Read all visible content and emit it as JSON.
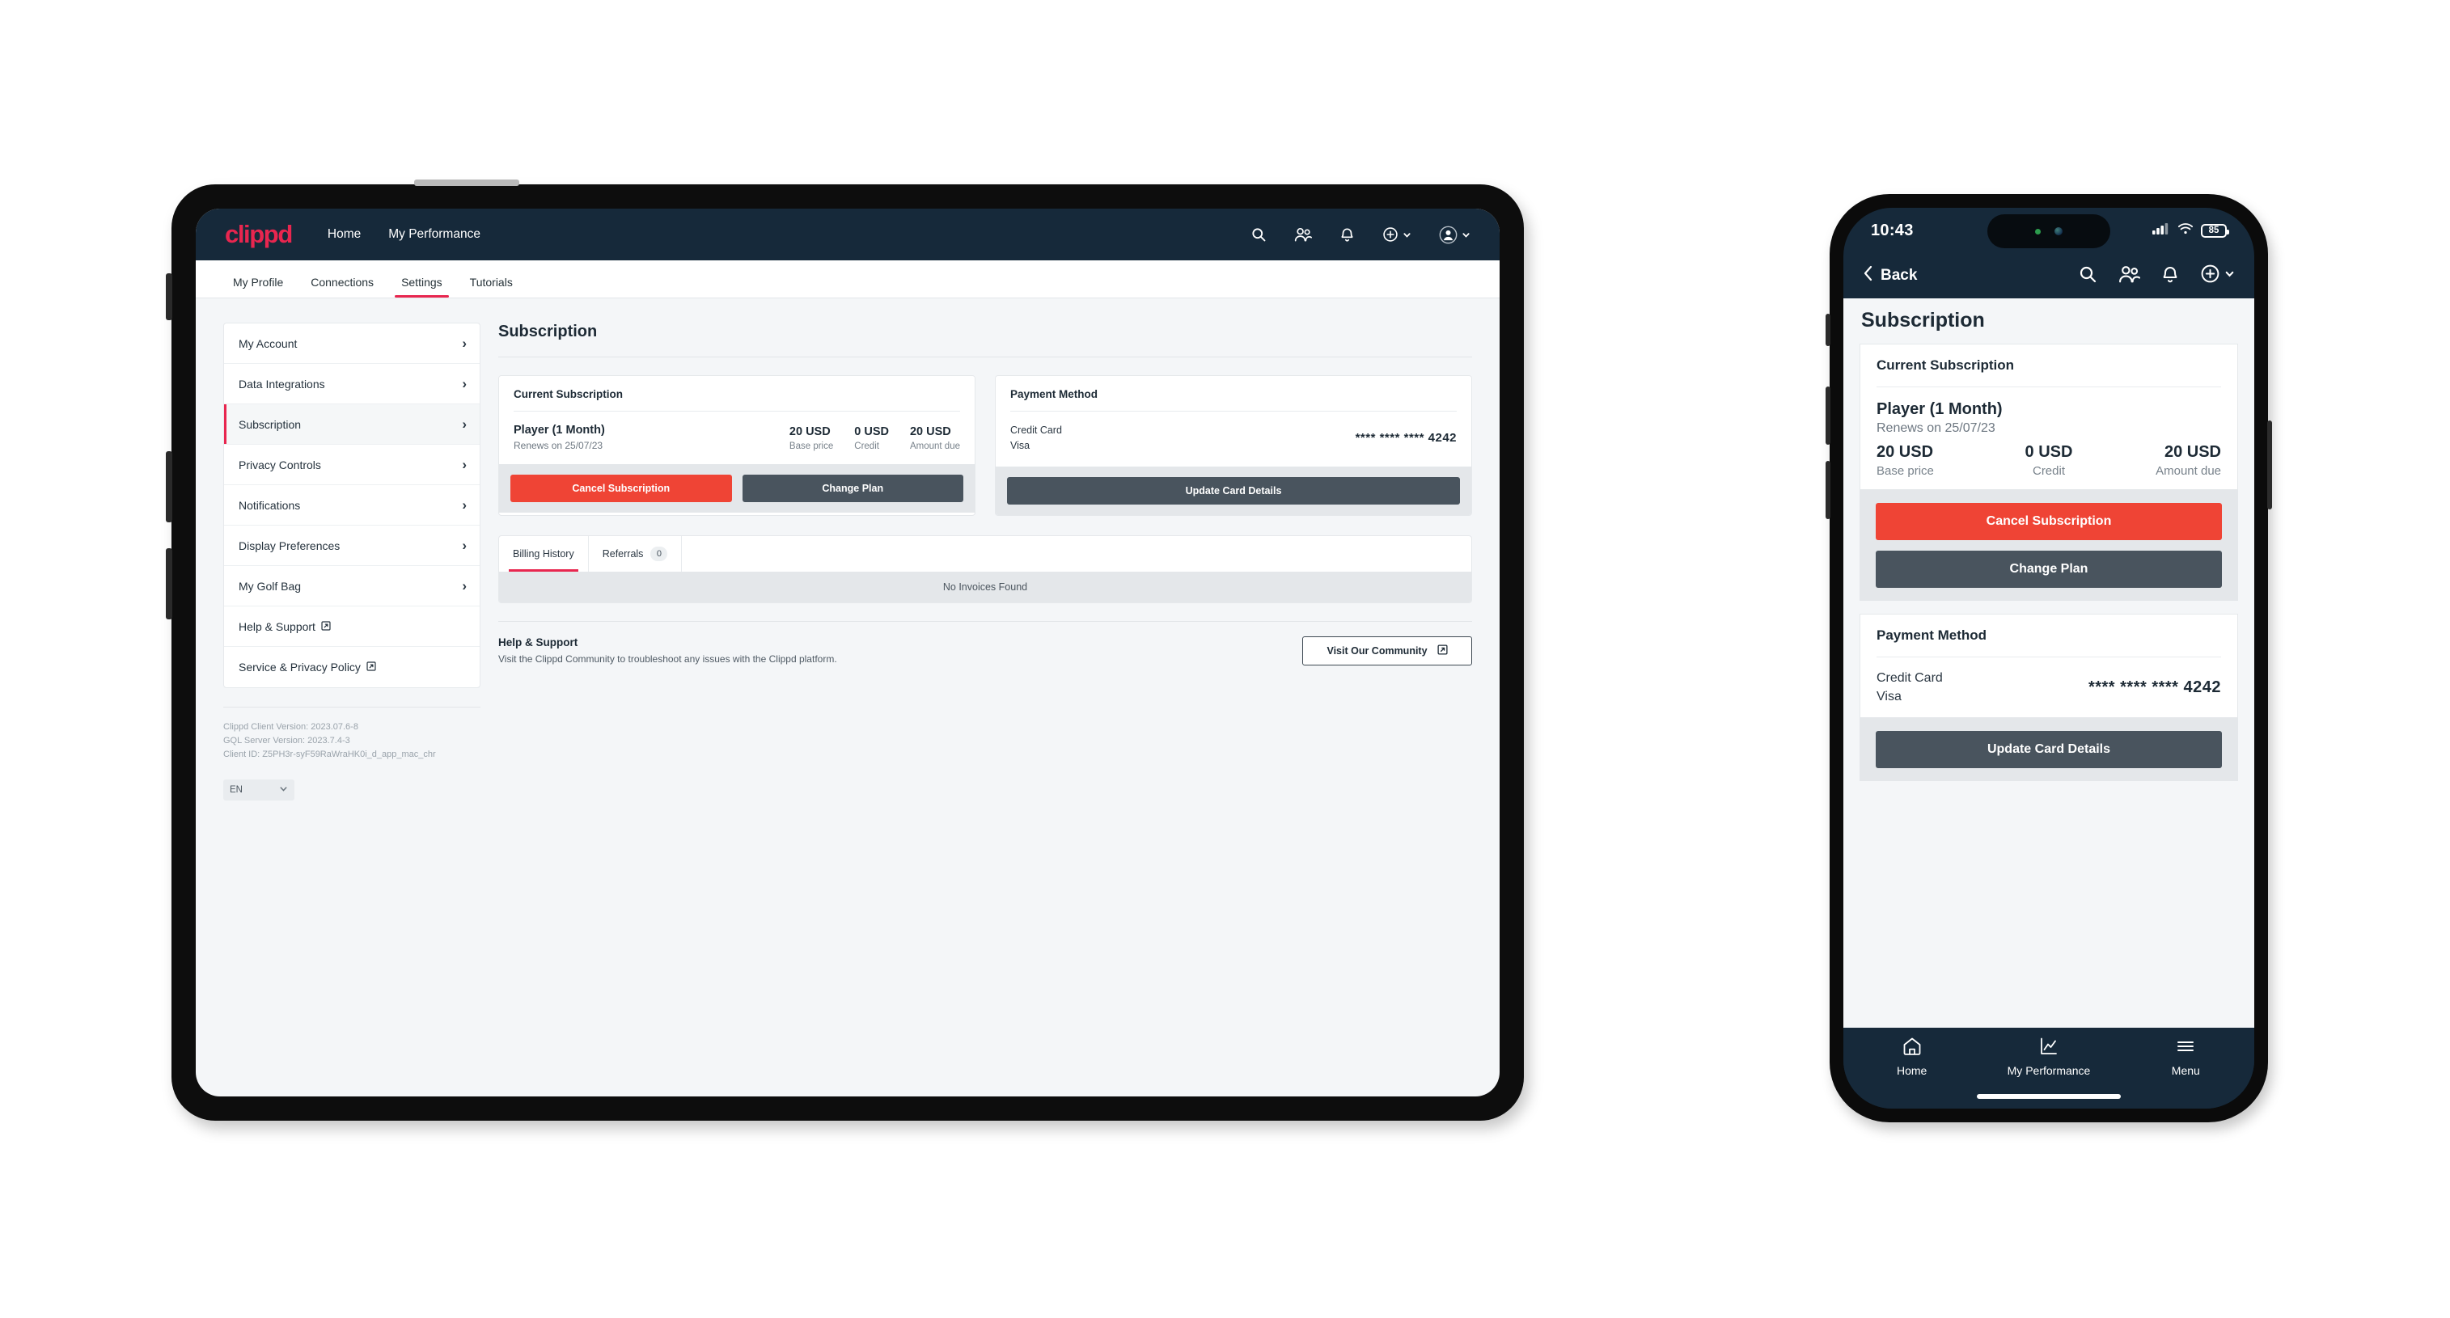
{
  "brand": {
    "logo_text": "clippd",
    "accent": "#e8264f",
    "navbar_bg": "#16293a",
    "danger": "#ef4435",
    "dark_button": "#49545e"
  },
  "tablet": {
    "navbar": {
      "links": [
        {
          "label": "Home"
        },
        {
          "label": "My Performance"
        }
      ],
      "icons": [
        {
          "name": "search-icon"
        },
        {
          "name": "people-icon"
        },
        {
          "name": "bell-icon"
        },
        {
          "name": "plus-circle-icon"
        },
        {
          "name": "avatar-icon"
        }
      ]
    },
    "subtabs": [
      {
        "label": "My Profile",
        "active": false
      },
      {
        "label": "Connections",
        "active": false
      },
      {
        "label": "Settings",
        "active": true
      },
      {
        "label": "Tutorials",
        "active": false
      }
    ],
    "sidebar": {
      "items": [
        {
          "label": "My Account",
          "active": false,
          "external": false
        },
        {
          "label": "Data Integrations",
          "active": false,
          "external": false
        },
        {
          "label": "Subscription",
          "active": true,
          "external": false
        },
        {
          "label": "Privacy Controls",
          "active": false,
          "external": false
        },
        {
          "label": "Notifications",
          "active": false,
          "external": false
        },
        {
          "label": "Display Preferences",
          "active": false,
          "external": false
        },
        {
          "label": "My Golf Bag",
          "active": false,
          "external": false
        },
        {
          "label": "Help & Support",
          "active": false,
          "external": true
        },
        {
          "label": "Service & Privacy Policy",
          "active": false,
          "external": true
        }
      ],
      "version": {
        "client": "Clippd Client Version: 2023.07.6-8",
        "server": "GQL Server Version: 2023.7.4-3",
        "client_id": "Client ID: Z5PH3r-syF59RaWraHK0i_d_app_mac_chr"
      },
      "language": "EN"
    },
    "main": {
      "page_title": "Subscription",
      "current_subscription": {
        "card_title": "Current Subscription",
        "plan_name": "Player (1 Month)",
        "renews": "Renews on 25/07/23",
        "amounts": [
          {
            "value": "20 USD",
            "label": "Base price"
          },
          {
            "value": "0 USD",
            "label": "Credit"
          },
          {
            "value": "20 USD",
            "label": "Amount due"
          }
        ],
        "cancel_label": "Cancel Subscription",
        "change_label": "Change Plan"
      },
      "payment_method": {
        "card_title": "Payment Method",
        "type": "Credit Card",
        "brand": "Visa",
        "number": "**** **** **** 4242",
        "update_label": "Update Card Details"
      },
      "tabs": [
        {
          "label": "Billing History",
          "badge": null,
          "active": true
        },
        {
          "label": "Referrals",
          "badge": "0",
          "active": false
        }
      ],
      "empty_state": "No Invoices Found",
      "help": {
        "title": "Help & Support",
        "description": "Visit the Clippd Community to troubleshoot any issues with the Clippd platform.",
        "button_label": "Visit Our Community"
      }
    }
  },
  "phone": {
    "status": {
      "time": "10:43",
      "battery": "85"
    },
    "nav": {
      "back_label": "Back",
      "icons": [
        {
          "name": "search-icon"
        },
        {
          "name": "people-icon"
        },
        {
          "name": "bell-icon"
        },
        {
          "name": "plus-circle-icon"
        }
      ]
    },
    "page_title": "Subscription",
    "current_subscription": {
      "card_title": "Current Subscription",
      "plan_name": "Player (1 Month)",
      "renews": "Renews on 25/07/23",
      "amounts": [
        {
          "value": "20 USD",
          "label": "Base price"
        },
        {
          "value": "0 USD",
          "label": "Credit"
        },
        {
          "value": "20 USD",
          "label": "Amount due"
        }
      ],
      "cancel_label": "Cancel Subscription",
      "change_label": "Change Plan"
    },
    "payment_method": {
      "card_title": "Payment Method",
      "type": "Credit Card",
      "brand": "Visa",
      "number": "**** **** **** 4242",
      "update_label": "Update Card Details"
    },
    "bottom_nav": [
      {
        "label": "Home",
        "icon": "home-icon"
      },
      {
        "label": "My Performance",
        "icon": "chart-icon"
      },
      {
        "label": "Menu",
        "icon": "hamburger-icon"
      }
    ]
  }
}
